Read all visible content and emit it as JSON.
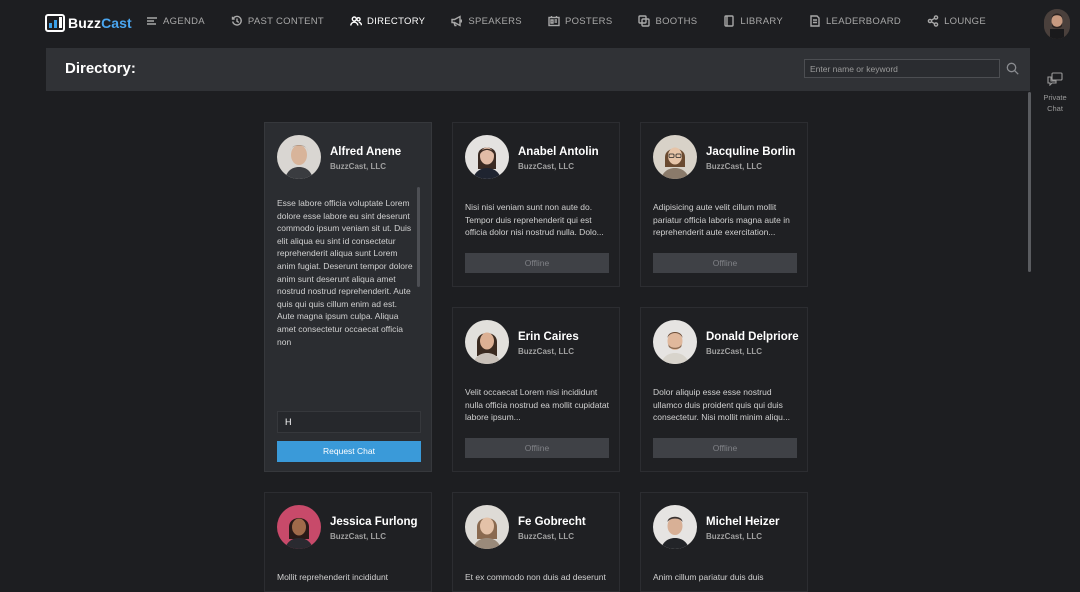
{
  "app": {
    "brand_part1": "Buzz",
    "brand_part2": "Cast"
  },
  "nav": {
    "items": [
      {
        "label": "AGENDA",
        "icon": "agenda-icon"
      },
      {
        "label": "PAST CONTENT",
        "icon": "history-icon"
      },
      {
        "label": "DIRECTORY",
        "icon": "people-icon",
        "active": true
      },
      {
        "label": "SPEAKERS",
        "icon": "megaphone-icon"
      },
      {
        "label": "POSTERS",
        "icon": "posters-icon"
      },
      {
        "label": "BOOTHS",
        "icon": "booths-icon"
      },
      {
        "label": "LIBRARY",
        "icon": "book-icon"
      },
      {
        "label": "LEADERBOARD",
        "icon": "leaderboard-icon"
      },
      {
        "label": "LOUNGE",
        "icon": "share-icon"
      }
    ]
  },
  "header": {
    "title": "Directory:",
    "search_placeholder": "Enter name or keyword"
  },
  "rail": {
    "private_chat_line1": "Private",
    "private_chat_line2": "Chat"
  },
  "cards": [
    {
      "name": "Alfred Anene",
      "company": "BuzzCast, LLC",
      "bio": "Esse labore officia voluptate Lorem dolore esse labore eu sint deserunt commodo ipsum veniam sit ut. Duis elit aliqua eu sint id consectetur reprehenderit aliqua sunt Lorem anim fugiat. Deserunt tempor dolore anim sunt deserunt aliqua amet nostrud nostrud reprehenderit. Aute quis qui quis cillum enim ad est. Aute magna ipsum culpa. Aliqua amet consectetur occaecat officia non",
      "chat_value": "H",
      "request_label": "Request Chat"
    },
    {
      "name": "Anabel Antolin",
      "company": "BuzzCast, LLC",
      "bio": "Nisi nisi veniam sunt non aute do. Tempor duis reprehenderit qui est officia dolor nisi nostrud nulla. Dolo...",
      "status": "Offline"
    },
    {
      "name": "Jacquline Borlin",
      "company": "BuzzCast, LLC",
      "bio": "Adipisicing aute velit cillum mollit pariatur officia laboris magna aute in reprehenderit aute exercitation...",
      "status": "Offline"
    },
    {
      "name": "Erin Caires",
      "company": "BuzzCast, LLC",
      "bio": "Velit occaecat Lorem nisi incididunt nulla officia nostrud ea mollit cupidatat labore ipsum...",
      "status": "Offline"
    },
    {
      "name": "Donald Delpriore",
      "company": "BuzzCast, LLC",
      "bio": "Dolor aliquip esse esse nostrud ullamco duis proident quis qui duis consectetur. Nisi mollit minim aliqu...",
      "status": "Offline"
    },
    {
      "name": "Jessica Furlong",
      "company": "BuzzCast, LLC",
      "bio": "Mollit reprehenderit incididunt"
    },
    {
      "name": "Fe Gobrecht",
      "company": "BuzzCast, LLC",
      "bio": "Et ex commodo non duis ad deserunt"
    },
    {
      "name": "Michel Heizer",
      "company": "BuzzCast, LLC",
      "bio": "Anim cillum pariatur duis duis"
    }
  ],
  "colors": {
    "accent": "#3a9ad9",
    "background": "#1d1e21",
    "header_bar": "#303236"
  }
}
